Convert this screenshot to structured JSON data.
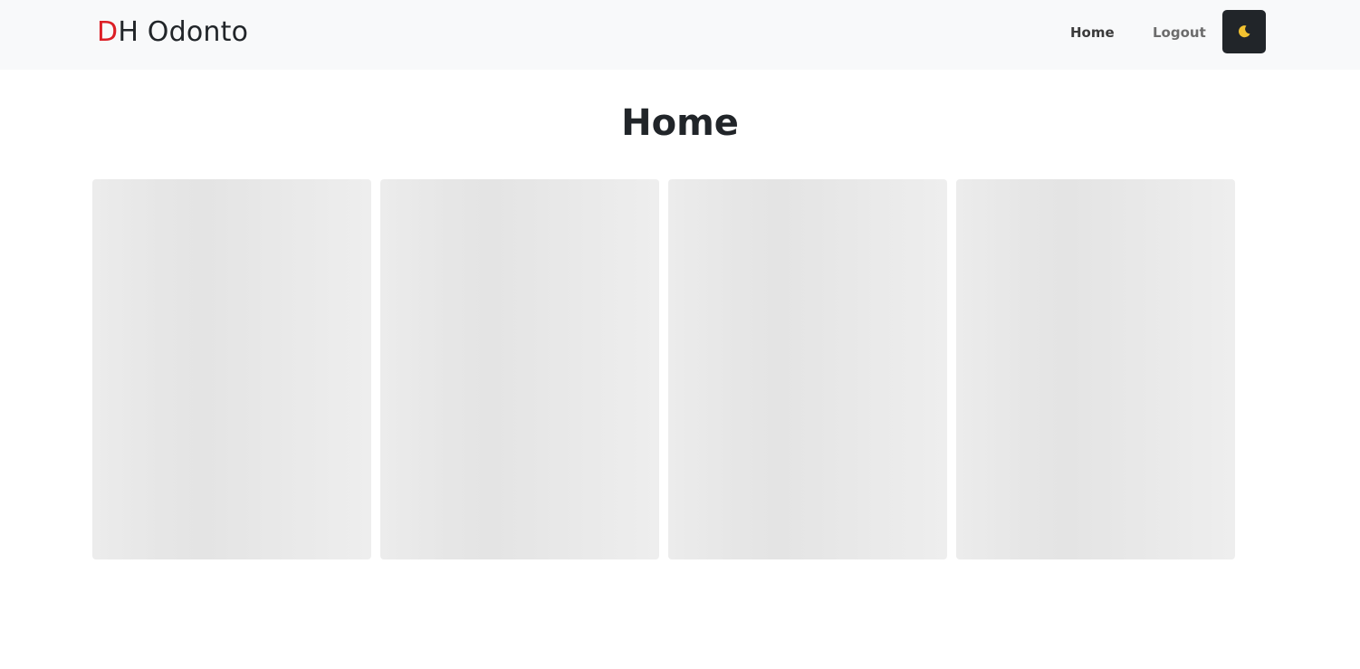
{
  "brand": {
    "accent_letter": "D",
    "rest": "H Odonto",
    "accent_color": "#dc1f26"
  },
  "nav": {
    "items": [
      {
        "label": "Home"
      },
      {
        "label": "Logout"
      }
    ],
    "theme_toggle_icon": "moon-icon",
    "theme_toggle_color": "#212529"
  },
  "main": {
    "title": "Home",
    "cards": [
      {
        "state": "loading-placeholder"
      },
      {
        "state": "loading-placeholder"
      },
      {
        "state": "loading-placeholder"
      },
      {
        "state": "loading-placeholder"
      }
    ]
  }
}
